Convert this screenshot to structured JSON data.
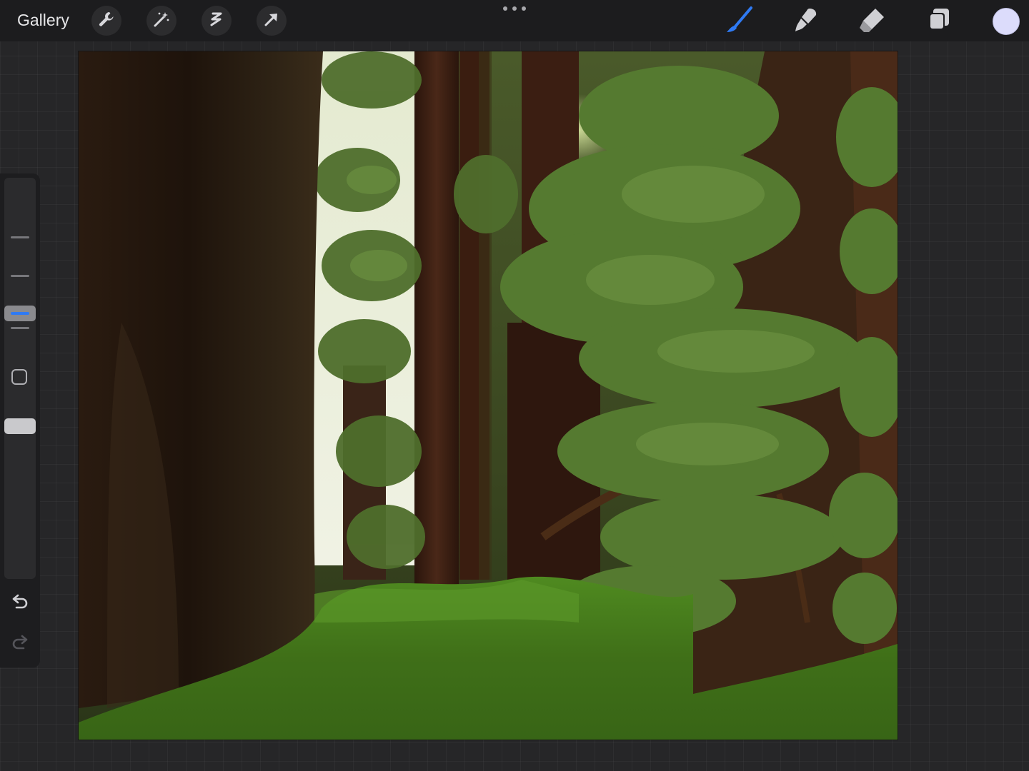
{
  "topbar": {
    "gallery_label": "Gallery",
    "left_tools": [
      "wrench-icon",
      "magic-wand-icon",
      "selection-icon",
      "transform-arrow-icon"
    ],
    "right_tools": [
      "brush-icon",
      "smudge-icon",
      "eraser-icon",
      "layers-icon"
    ],
    "active_tool": "brush-icon",
    "active_color": "#dcdcfb",
    "accent": "#2f7af3"
  },
  "sidebar": {
    "controls": [
      "brush-size-slider",
      "modify-button",
      "opacity-slider",
      "undo-button",
      "redo-button"
    ]
  },
  "canvas": {
    "subject": "painted-forest"
  }
}
